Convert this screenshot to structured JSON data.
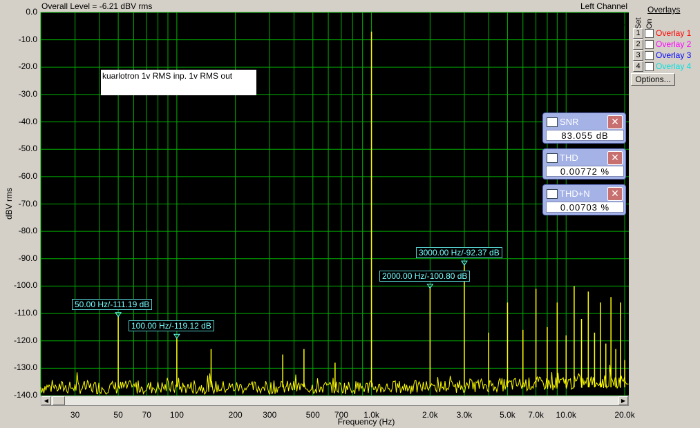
{
  "header": {
    "overall_level": "Overall Level = -6.21 dBV rms",
    "channel": "Left Channel"
  },
  "overlays": {
    "title": "Overlays",
    "set_label": "Set",
    "on_label": "On",
    "items": [
      {
        "num": "1",
        "label": "Overlay 1",
        "color": "#ff0000"
      },
      {
        "num": "2",
        "label": "Overlay 2",
        "color": "#ff00ff"
      },
      {
        "num": "3",
        "label": "Overlay 3",
        "color": "#0000ff"
      },
      {
        "num": "4",
        "label": "Overlay 4",
        "color": "#00e0e0"
      }
    ],
    "options_label": "Options..."
  },
  "meters": [
    {
      "title": "SNR",
      "value": "83.055  dB"
    },
    {
      "title": "THD",
      "value": "0.00772  %"
    },
    {
      "title": "THD+N",
      "value": "0.00703  %"
    }
  ],
  "colors": {
    "plot_bg": "#000000",
    "grid": "#00b000",
    "trace": "#ffff00",
    "marker": "#66ffff"
  },
  "chart_data": {
    "type": "line",
    "title": "",
    "annotation": "kuarlotron 1v RMS inp. 1v RMS out",
    "xlabel": "Frequency (Hz)",
    "ylabel": "dBV rms",
    "xscale": "log",
    "xlim": [
      20,
      21000
    ],
    "ylim": [
      -140,
      0
    ],
    "yticks": [
      "0.0",
      "-10.0",
      "-20.0",
      "-30.0",
      "-40.0",
      "-50.0",
      "-60.0",
      "-70.0",
      "-80.0",
      "-90.0",
      "-100.0",
      "-110.0",
      "-120.0",
      "-130.0",
      "-140.0"
    ],
    "xticks": [
      {
        "v": 30,
        "label": "30"
      },
      {
        "v": 50,
        "label": "50"
      },
      {
        "v": 70,
        "label": "70"
      },
      {
        "v": 100,
        "label": "100"
      },
      {
        "v": 200,
        "label": "200"
      },
      {
        "v": 300,
        "label": "300"
      },
      {
        "v": 500,
        "label": "500"
      },
      {
        "v": 700,
        "label": "700"
      },
      {
        "v": 1000,
        "label": "1.0k"
      },
      {
        "v": 2000,
        "label": "2.0k"
      },
      {
        "v": 3000,
        "label": "3.0k"
      },
      {
        "v": 5000,
        "label": "5.0k"
      },
      {
        "v": 7000,
        "label": "7.0k"
      },
      {
        "v": 10000,
        "label": "10.0k"
      },
      {
        "v": 20000,
        "label": "20.0k"
      }
    ],
    "grid": true,
    "noise_floor": -137,
    "peaks": [
      {
        "f": 50,
        "db": -111.19
      },
      {
        "f": 100,
        "db": -119.12
      },
      {
        "f": 150,
        "db": -123
      },
      {
        "f": 350,
        "db": -125
      },
      {
        "f": 450,
        "db": -123
      },
      {
        "f": 650,
        "db": -128
      },
      {
        "f": 1000,
        "db": -7
      },
      {
        "f": 2000,
        "db": -100.8
      },
      {
        "f": 3000,
        "db": -92.37
      },
      {
        "f": 4000,
        "db": -117
      },
      {
        "f": 5000,
        "db": -106
      },
      {
        "f": 6000,
        "db": -116
      },
      {
        "f": 7000,
        "db": -101
      },
      {
        "f": 8000,
        "db": -115
      },
      {
        "f": 9000,
        "db": -106
      },
      {
        "f": 10000,
        "db": -118
      },
      {
        "f": 11000,
        "db": -100
      },
      {
        "f": 12000,
        "db": -112
      },
      {
        "f": 13000,
        "db": -102
      },
      {
        "f": 14000,
        "db": -117
      },
      {
        "f": 15000,
        "db": -106
      },
      {
        "f": 16000,
        "db": -121
      },
      {
        "f": 17000,
        "db": -104
      },
      {
        "f": 18000,
        "db": -123
      },
      {
        "f": 19000,
        "db": -106
      },
      {
        "f": 20000,
        "db": -127
      }
    ],
    "markers": [
      {
        "f": 50,
        "db": -111.19,
        "label": "50.00 Hz/-111.19 dB"
      },
      {
        "f": 100,
        "db": -119.12,
        "label": "100.00 Hz/-119.12 dB"
      },
      {
        "f": 2000,
        "db": -100.8,
        "label": "2000.00 Hz/-100.80 dB"
      },
      {
        "f": 3000,
        "db": -92.37,
        "label": "3000.00 Hz/-92.37 dB"
      }
    ]
  }
}
